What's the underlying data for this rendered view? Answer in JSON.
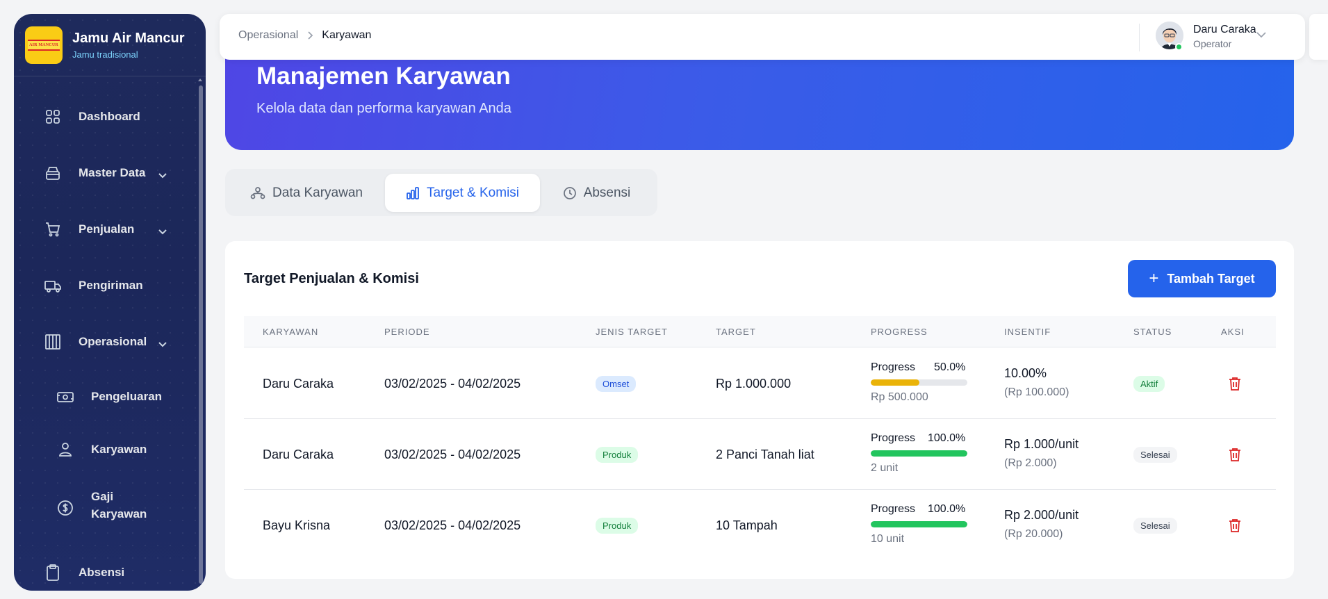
{
  "sidebar": {
    "brand_title": "Jamu Air Mancur",
    "brand_sub": "Jamu tradisional",
    "logo_text": "AIR MANCUR",
    "items": [
      {
        "label": "Dashboard",
        "icon": "grid-icon"
      },
      {
        "label": "Master Data",
        "icon": "layers-icon"
      },
      {
        "label": "Penjualan",
        "icon": "cart-icon"
      },
      {
        "label": "Pengiriman",
        "icon": "truck-icon"
      },
      {
        "label": "Operasional",
        "icon": "columns-icon"
      },
      {
        "label": "Pengeluaran",
        "icon": "cash-icon"
      },
      {
        "label": "Karyawan",
        "icon": "user-icon"
      },
      {
        "label": "Gaji Karyawan",
        "icon": "dollar-icon"
      },
      {
        "label": "Absensi",
        "icon": "clipboard-icon"
      }
    ]
  },
  "topbar": {
    "breadcrumb": [
      "Operasional",
      "Karyawan"
    ],
    "user_name": "Daru Caraka",
    "user_role": "Operator"
  },
  "hero": {
    "title": "Manajemen Karyawan",
    "subtitle": "Kelola data dan performa karyawan Anda"
  },
  "tabs": [
    {
      "label": "Data Karyawan",
      "active": false
    },
    {
      "label": "Target & Komisi",
      "active": true
    },
    {
      "label": "Absensi",
      "active": false
    }
  ],
  "card": {
    "title": "Target Penjualan & Komisi",
    "add_button": "Tambah Target",
    "columns": [
      "KARYAWAN",
      "PERIODE",
      "JENIS TARGET",
      "TARGET",
      "PROGRESS",
      "INSENTIF",
      "STATUS",
      "AKSI"
    ],
    "rows": [
      {
        "karyawan": "Daru Caraka",
        "periode": "03/02/2025 - 04/02/2025",
        "jenis": "Omset",
        "target": "Rp 1.000.000",
        "progress_label": "Progress",
        "progress_pct": "50.0%",
        "progress_value": 50,
        "progress_color": "#eab308",
        "progress_sub": "Rp 500.000",
        "insentif": "10.00%",
        "insentif_sub": "(Rp 100.000)",
        "status": "Aktif"
      },
      {
        "karyawan": "Daru Caraka",
        "periode": "03/02/2025 - 04/02/2025",
        "jenis": "Produk",
        "target": "2 Panci Tanah liat",
        "progress_label": "Progress",
        "progress_pct": "100.0%",
        "progress_value": 100,
        "progress_color": "#22c55e",
        "progress_sub": "2 unit",
        "insentif": "Rp 1.000/unit",
        "insentif_sub": "(Rp 2.000)",
        "status": "Selesai"
      },
      {
        "karyawan": "Bayu Krisna",
        "periode": "03/02/2025 - 04/02/2025",
        "jenis": "Produk",
        "target": "10 Tampah",
        "progress_label": "Progress",
        "progress_pct": "100.0%",
        "progress_value": 100,
        "progress_color": "#22c55e",
        "progress_sub": "10 unit",
        "insentif": "Rp 2.000/unit",
        "insentif_sub": "(Rp 20.000)",
        "status": "Selesai"
      }
    ]
  }
}
